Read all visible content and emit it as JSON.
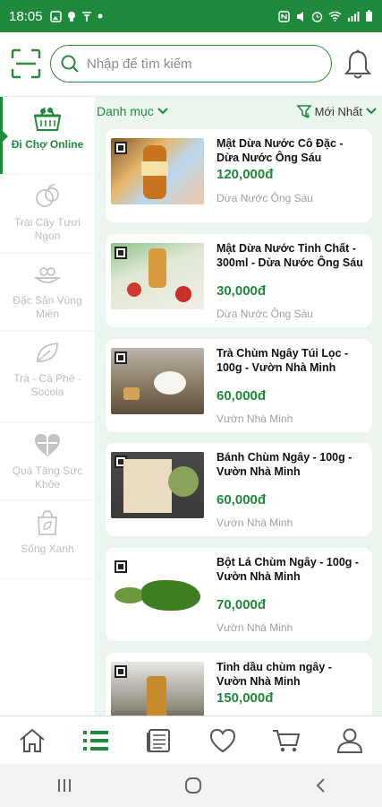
{
  "status_bar": {
    "time": "18:05"
  },
  "search": {
    "placeholder": "Nhập để tìm kiếm"
  },
  "sidebar": {
    "items": [
      {
        "label": "Đi Chợ Online",
        "icon": "basket-icon",
        "active": true
      },
      {
        "label": "Trái Cây Tươi Ngon",
        "icon": "fruit-icon",
        "active": false
      },
      {
        "label": "Đặc Sản Vùng Miền",
        "icon": "specialty-icon",
        "active": false
      },
      {
        "label": "Trà - Cà Phê - Socola",
        "icon": "tea-leaf-icon",
        "active": false
      },
      {
        "label": "Quà Tặng Sức Khỏe",
        "icon": "gift-heart-icon",
        "active": false
      },
      {
        "label": "Sống Xanh",
        "icon": "green-bag-icon",
        "active": false
      }
    ]
  },
  "filter": {
    "category_label": "Danh mục",
    "sort_label": "Mới Nhất"
  },
  "products": [
    {
      "name": "Mật Dừa Nước Cô Đặc - Dừa Nước Ông Sáu",
      "price": "120,000đ",
      "shop": "Dừa Nước Ông Sáu"
    },
    {
      "name": "Mật Dừa Nước Tinh Chất - 300ml - Dừa Nước Ông Sáu",
      "price": "30,000đ",
      "shop": "Dừa Nước Ông Sáu"
    },
    {
      "name": "Trà Chùm Ngây Túi Lọc - 100g - Vườn Nhà Minh",
      "price": "60,000đ",
      "shop": "Vườn Nhà Minh"
    },
    {
      "name": "Bánh Chùm Ngây - 100g - Vườn Nhà Minh",
      "price": "60,000đ",
      "shop": "Vườn Nhà Minh"
    },
    {
      "name": "Bột Lá Chùm Ngây - 100g - Vườn Nhà Minh",
      "price": "70,000đ",
      "shop": "Vườn Nhà Minh"
    },
    {
      "name": "Tinh dầu chùm ngây - Vườn Nhà Minh",
      "price": "150,000đ",
      "shop": ""
    }
  ],
  "colors": {
    "brand": "#1f8a3c",
    "content_bg": "#eaf5ed"
  }
}
